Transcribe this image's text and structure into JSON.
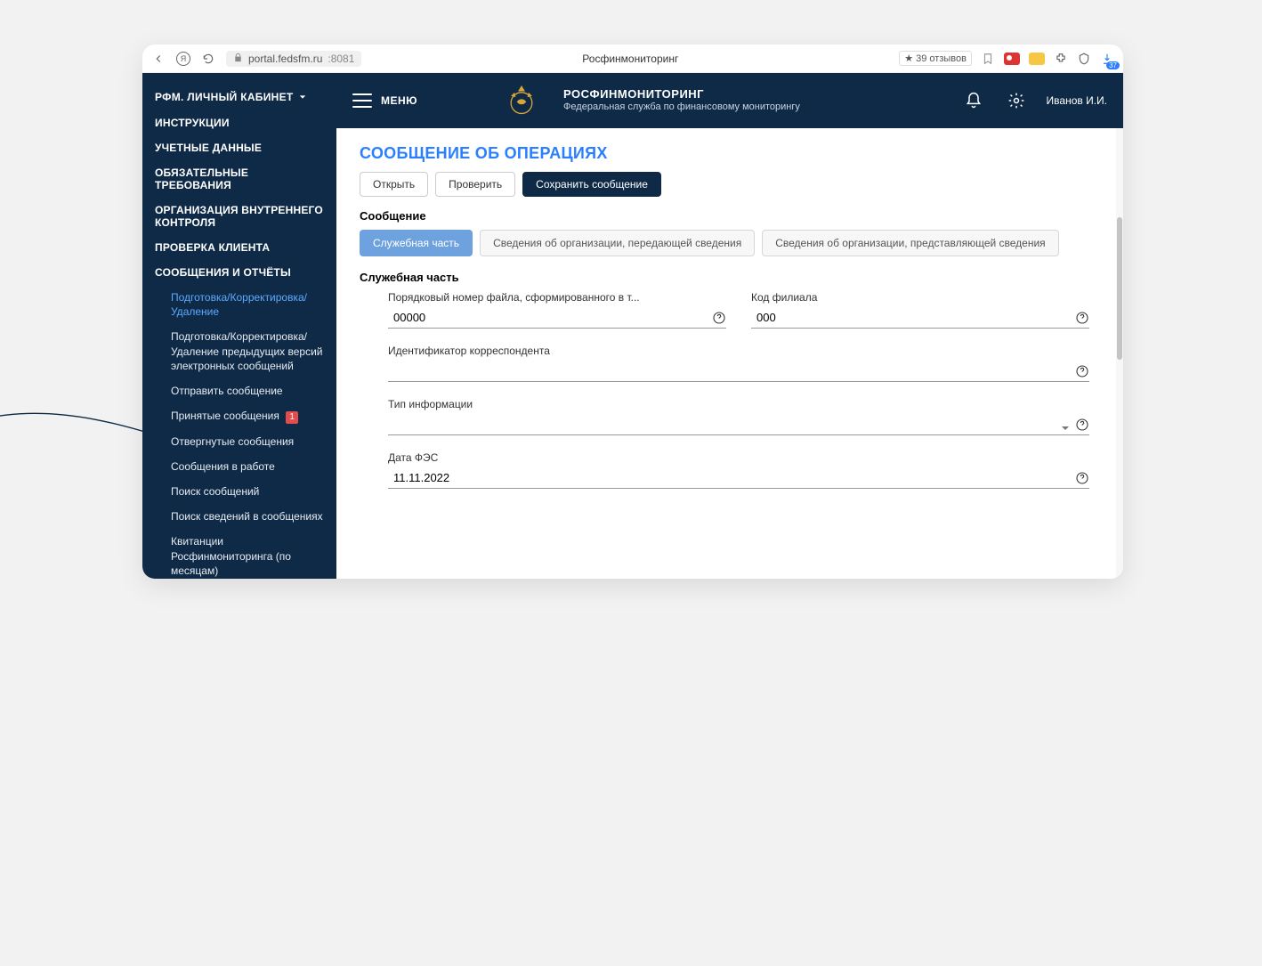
{
  "browser": {
    "tab_title": "Росфинмониторинг",
    "address_host": "portal.fedsfm.ru",
    "address_port": ":8081",
    "reviews_label": "★ 39 отзывов",
    "download_count": "37"
  },
  "sidebar": {
    "cabinet_label": "РФМ. ЛИЧНЫЙ КАБИНЕТ",
    "items": [
      "ИНСТРУКЦИИ",
      "УЧЕТНЫЕ ДАННЫЕ",
      "ОБЯЗАТЕЛЬНЫЕ ТРЕБОВАНИЯ",
      "ОРГАНИЗАЦИЯ ВНУТРЕННЕГО КОНТРОЛЯ",
      "ПРОВЕРКА КЛИЕНТА",
      "СООБЩЕНИЯ И ОТЧЁТЫ"
    ],
    "subitems": [
      {
        "label": "Подготовка/Корректировка/ Удаление",
        "active": true
      },
      {
        "label": "Подготовка/Корректировка/ Удаление предыдущих версий электронных сообщений"
      },
      {
        "label": "Отправить сообщение"
      },
      {
        "label": "Принятые сообщения",
        "badge": "1"
      },
      {
        "label": "Отвергнутые сообщения"
      },
      {
        "label": "Сообщения в работе"
      },
      {
        "label": "Поиск сообщений"
      },
      {
        "label": "Поиск сведений в сообщениях"
      },
      {
        "label": "Квитанции Росфинмониторинга (по месяцам)"
      }
    ]
  },
  "topbar": {
    "menu_label": "МЕНЮ",
    "org_title": "РОСФИНМОНИТОРИНГ",
    "org_sub": "Федеральная служба по финансовому мониторингу",
    "user_name": "Иванов И.И."
  },
  "page": {
    "title": "СООБЩЕНИЕ ОБ ОПЕРАЦИЯХ",
    "buttons": {
      "open": "Открыть",
      "check": "Проверить",
      "save": "Сохранить сообщение"
    },
    "section_message_label": "Сообщение",
    "tabs": [
      "Служебная часть",
      "Сведения об организации, передающей сведения",
      "Сведения об организации, представляющей сведения"
    ],
    "section_service_label": "Служебная часть",
    "fields": {
      "file_no": {
        "label": "Порядковый номер файла, сформированного в т...",
        "value": "00000"
      },
      "branch": {
        "label": "Код филиала",
        "value": "000"
      },
      "corr_id": {
        "label": "Идентификатор корреспондента",
        "value": ""
      },
      "info_type": {
        "label": "Тип информации",
        "value": ""
      },
      "fes_date": {
        "label": "Дата ФЭС",
        "value": "11.11.2022"
      }
    }
  }
}
